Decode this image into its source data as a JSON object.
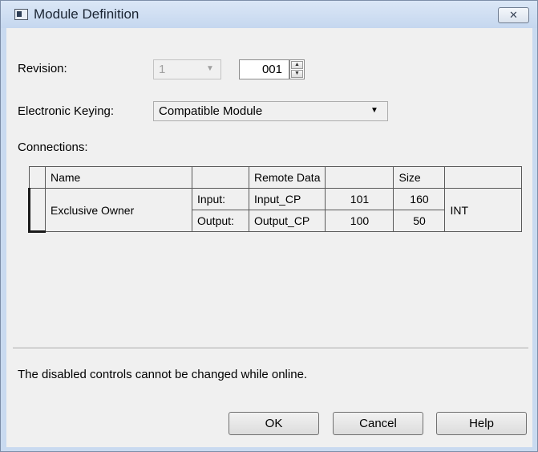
{
  "window": {
    "title": "Module Definition",
    "close_glyph": "✕"
  },
  "form": {
    "revision_label": "Revision:",
    "revision_major": "1",
    "revision_minor": "001",
    "keying_label": "Electronic Keying:",
    "keying_value": "Compatible Module",
    "connections_label": "Connections:"
  },
  "table": {
    "headers": {
      "name": "Name",
      "remote_data": "Remote Data",
      "size": "Size"
    },
    "row": {
      "name": "Exclusive Owner",
      "input_label": "Input:",
      "input_tag": "Input_CP",
      "input_instance": "101",
      "input_size": "160",
      "output_label": "Output:",
      "output_tag": "Output_CP",
      "output_instance": "100",
      "output_size": "50",
      "data_type": "INT"
    }
  },
  "status_message": "The disabled controls cannot be changed while online.",
  "buttons": {
    "ok": "OK",
    "cancel": "Cancel",
    "help": "Help"
  },
  "icons": {
    "window": "module-icon",
    "close": "close-icon",
    "dropdown": "chevron-down-icon",
    "spin": "spinner-arrows-icon"
  },
  "colors": {
    "titlebar": "#c5d7ef",
    "client_bg": "#f0f0f0",
    "disabled_text": "#a0a0a0"
  }
}
